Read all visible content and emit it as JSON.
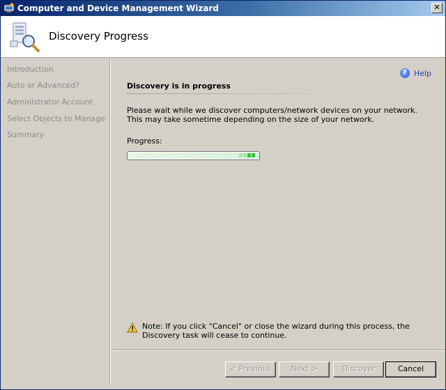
{
  "window": {
    "title": "Computer and Device Management Wizard"
  },
  "header": {
    "title": "Discovery Progress"
  },
  "sidebar": {
    "items": [
      {
        "label": "Introduction"
      },
      {
        "label": "Auto or Advanced?"
      },
      {
        "label": "Administrator Account"
      },
      {
        "label": "Select Objects to Manage"
      },
      {
        "label": "Summary"
      }
    ]
  },
  "main": {
    "help_label": "Help",
    "section_title": "Discovery is in progress",
    "description": "Please wait while we discover computers/network devices on your network. This may take sometime depending on the size of your network.",
    "progress_label": "Progress:",
    "note": "Note:  If you click \"Cancel\" or close the wizard during this process, the Discovery task will cease to continue."
  },
  "buttons": {
    "previous": "< Previous",
    "next": "Next >",
    "discover": "Discover",
    "cancel": "Cancel"
  },
  "colors": {
    "titlebar": "#0a246a",
    "progress_green": "#38c038",
    "link": "#1c40b0"
  }
}
